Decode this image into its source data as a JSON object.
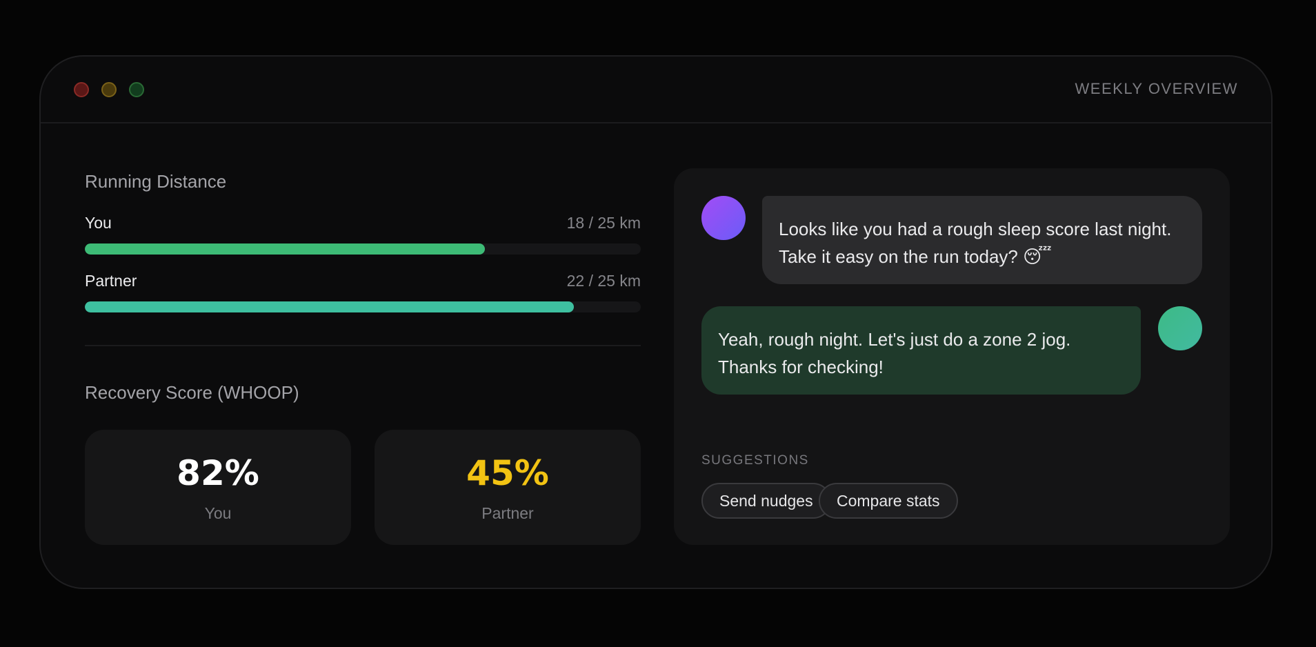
{
  "window": {
    "title": "WEEKLY OVERVIEW"
  },
  "running": {
    "title": "Running Distance",
    "rows": [
      {
        "label": "You",
        "value": "18 / 25 km",
        "progress": 0.72,
        "color": "#3dbb76"
      },
      {
        "label": "Partner",
        "value": "22 / 25 km",
        "progress": 0.88,
        "color": "#3ec0a0"
      }
    ]
  },
  "recovery": {
    "title": "Recovery Score (WHOOP)",
    "cards": [
      {
        "value": "82%",
        "label": "You",
        "color": "#ffffff"
      },
      {
        "value": "45%",
        "label": "Partner",
        "color": "#f2c313"
      }
    ]
  },
  "chat": {
    "messages": [
      {
        "from": "coach",
        "text": "Looks like you had a rough sleep score last night. Take it easy on the run today? 😴"
      },
      {
        "from": "user",
        "text": "Yeah, rough night. Let's just do a zone 2 jog. Thanks for checking!"
      }
    ],
    "suggestions_label": "SUGGESTIONS",
    "suggestions": [
      "Send nudges",
      "Compare stats"
    ]
  }
}
